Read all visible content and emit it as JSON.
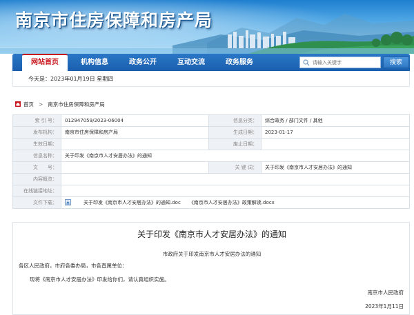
{
  "header": {
    "site_title": "南京市住房保障和房产局"
  },
  "nav": {
    "items": [
      {
        "label": "网站首页",
        "active": true
      },
      {
        "label": "机构信息",
        "active": false
      },
      {
        "label": "政务公开",
        "active": false
      },
      {
        "label": "互动交流",
        "active": false
      },
      {
        "label": "政务服务",
        "active": false
      }
    ],
    "search": {
      "placeholder": "请输入关键字",
      "button_label": "搜索"
    }
  },
  "datebar": {
    "today": "今天是：2023年01月19日 星期四"
  },
  "breadcrumb": {
    "home": "首页",
    "separator": ">",
    "current": "南京市住房保障和房产局"
  },
  "info": {
    "index_no": {
      "label": "索 引 号：",
      "value": "012947059/2023-06004"
    },
    "category": {
      "label": "信息分类：",
      "value": "综合政务 / 部门文件 / 其他"
    },
    "publisher": {
      "label": "发布机构：",
      "value": "南京市住房保障和房产局"
    },
    "created": {
      "label": "生成日期：",
      "value": "2023-01-17"
    },
    "effective": {
      "label": "生效日期：",
      "value": ""
    },
    "expiry": {
      "label": "废止日期：",
      "value": ""
    },
    "name": {
      "label": "信息名称：",
      "value": "关于印发《南京市人才安居办法》的通知"
    },
    "doc_no": {
      "label": "文　　号：",
      "value": ""
    },
    "keywords": {
      "label": "关 键 词：",
      "value": "关于印发《南京市人才安居办法》的通知"
    },
    "overview": {
      "label": "内容概览：",
      "value": ""
    },
    "online_link": {
      "label": "在线链接地址：",
      "value": ""
    },
    "downloads": {
      "label": "文件下载：",
      "files": [
        "关于印发《南京市人才安居办法》的通知.doc",
        "《南京市人才安居办法》政策解读.docx"
      ]
    }
  },
  "document": {
    "title": "关于印发《南京市人才安居办法》的通知",
    "issuer_line": "市政府关于印发南京市人才安居办法的通知",
    "addressees": "各区人民政府，市府各委办局，市各直属单位：",
    "body": "现将《南京市人才安居办法》印发给你们，请认真组织实施。",
    "signature": "南京市人民政府",
    "date": "2023年1月11日"
  },
  "colors": {
    "nav_blue": "#1a5fae",
    "active_red": "#c8161d",
    "label_bg": "#eef2f6"
  }
}
